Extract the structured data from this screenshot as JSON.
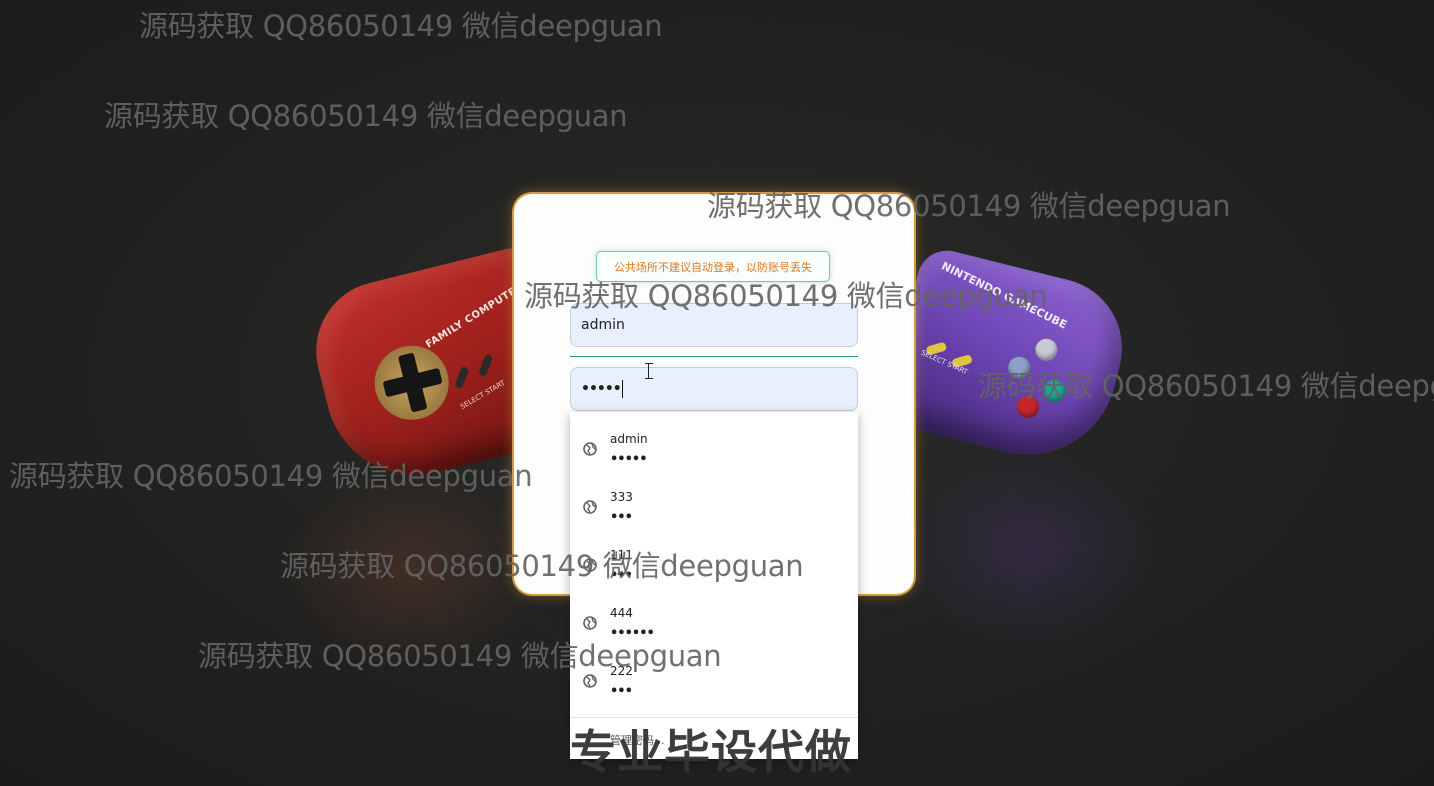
{
  "background": {
    "left_controller": {
      "brand": "FAMILY COMPUTER",
      "buttons_text": "SELECT START"
    },
    "right_controller": {
      "brand": "NINTENDO GAMECUBE",
      "buttons_text": "SELECT START"
    }
  },
  "login": {
    "notice": "公共场所不建议自动登录，以防账号丢失",
    "username_value": "admin",
    "password_value": "•••••"
  },
  "autofill": {
    "suggestions": [
      {
        "username": "admin",
        "password_mask": "•••••"
      },
      {
        "username": "333",
        "password_mask": "•••"
      },
      {
        "username": "111",
        "password_mask": "•••"
      },
      {
        "username": "444",
        "password_mask": "••••••"
      },
      {
        "username": "222",
        "password_mask": "•••"
      }
    ],
    "manage_label": "管理密码..."
  },
  "watermarks": [
    "源码获取 QQ86050149 微信deepguan",
    "源码获取 QQ86050149 微信deepguan",
    "源码获取 QQ86050149 微信deepguan",
    "源码获取 QQ86050149 微信deepguan",
    "源码获取 QQ86050149 微信deepgu",
    "源码获取 QQ86050149 微信deepguan",
    "源码获取 QQ86050149 微信deepguan",
    "源码获取 QQ86050149 微信deepguan"
  ],
  "banner": "专业毕设代做",
  "colors": {
    "card_glow": "#d59a3e",
    "notice_border": "#72c7a4",
    "notice_text": "#e0771f",
    "autofill_field_bg": "#e8f0fe",
    "focus_underline": "#2f9b6a"
  }
}
